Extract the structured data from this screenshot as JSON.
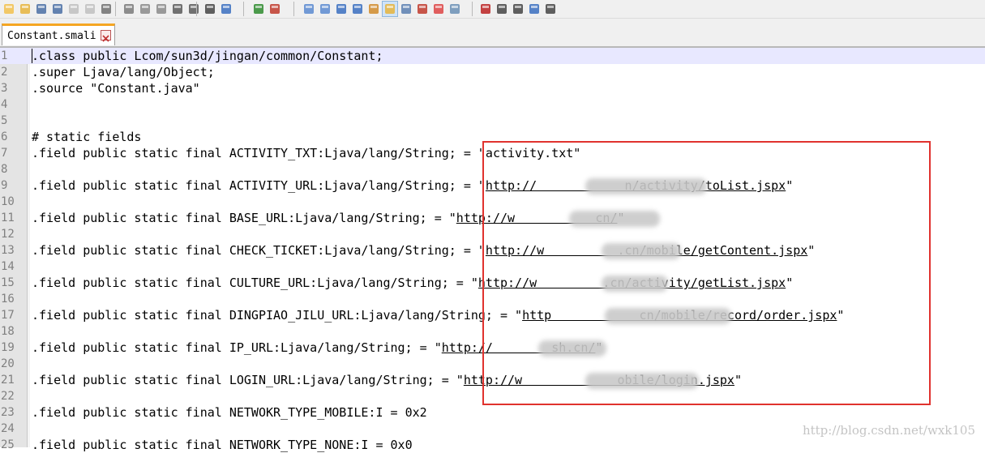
{
  "toolbar": {
    "icons": [
      "new-file-icon",
      "open-file-icon",
      "save-icon",
      "save-all-icon",
      "close-icon",
      "close-all-icon",
      "print-icon",
      "cut-icon",
      "copy-icon",
      "paste-icon",
      "undo-icon",
      "redo-icon",
      "find-icon",
      "replace-icon",
      "zoom-in-icon",
      "zoom-out-icon",
      "sync-vertical-icon",
      "sync-horizontal-icon",
      "word-wrap-icon",
      "show-all-chars-icon",
      "indent-guide-icon",
      "doc-map-icon",
      "language-icon",
      "function-list-icon",
      "folder-icon",
      "monitor-icon",
      "record-macro-icon",
      "stop-macro-icon",
      "play-macro-icon",
      "run-macro-multiple-icon",
      "save-macro-icon"
    ]
  },
  "tab": {
    "label": "Constant.smali"
  },
  "lines": [
    {
      "n": "1",
      "text": ".class public Lcom/sun3d/jingan/common/Constant;"
    },
    {
      "n": "2",
      "text": ".super Ljava/lang/Object;"
    },
    {
      "n": "3",
      "text": ".source \"Constant.java\""
    },
    {
      "n": "4",
      "text": ""
    },
    {
      "n": "5",
      "text": ""
    },
    {
      "n": "6",
      "text": "# static fields"
    },
    {
      "n": "7",
      "text": ".field public static final ACTIVITY_TXT:Ljava/lang/String; = \"activity.txt\""
    },
    {
      "n": "8",
      "text": ""
    },
    {
      "n": "9",
      "pre": ".field public static final ACTIVITY_URL:Ljava/lang/String; = \"",
      "link": "http://            n/activity/toList.jspx",
      "post": "\""
    },
    {
      "n": "10",
      "text": ""
    },
    {
      "n": "11",
      "pre": ".field public static final BASE_URL:Ljava/lang/String; = \"",
      "link": "http://w           cn/",
      "post": "\""
    },
    {
      "n": "12",
      "text": ""
    },
    {
      "n": "13",
      "pre": ".field public static final CHECK_TICKET:Ljava/lang/String; = \"",
      "link": "http://w          .cn/mobile/getContent.jspx",
      "post": "\""
    },
    {
      "n": "14",
      "text": ""
    },
    {
      "n": "15",
      "pre": ".field public static final CULTURE_URL:Ljava/lang/String; = \"",
      "link": "http://w         .cn/activity/getList.jspx",
      "post": "\""
    },
    {
      "n": "16",
      "text": ""
    },
    {
      "n": "17",
      "pre": ".field public static final DINGPIAO_JILU_URL:Ljava/lang/String; = \"",
      "link": "http            cn/mobile/record/order.jspx",
      "post": "\""
    },
    {
      "n": "18",
      "text": ""
    },
    {
      "n": "19",
      "pre": ".field public static final IP_URL:Ljava/lang/String; = \"",
      "link": "http://        sh.cn/",
      "post": "\""
    },
    {
      "n": "20",
      "text": ""
    },
    {
      "n": "21",
      "pre": ".field public static final LOGIN_URL:Ljava/lang/String; = \"",
      "link": "http://w             obile/login.jspx",
      "post": "\""
    },
    {
      "n": "22",
      "text": ""
    },
    {
      "n": "23",
      "text": ".field public static final NETWOKR_TYPE_MOBILE:I = 0x2"
    },
    {
      "n": "24",
      "text": ""
    },
    {
      "n": "25",
      "text": ".field public static final NETWORK_TYPE_NONE:I = 0x0"
    }
  ],
  "watermark": "http://blog.csdn.net/wxk105",
  "colors": {
    "annotation_box": "#e0322e",
    "current_line": "#e8e8ff",
    "tab_accent": "#f5a623"
  }
}
